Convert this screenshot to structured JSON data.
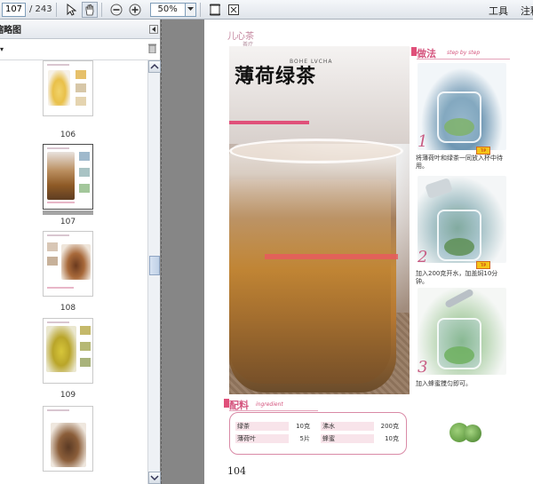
{
  "toolbar": {
    "current_page": "107",
    "total_pages": "/ 243",
    "zoom": "50%",
    "tools_label": "工具",
    "annotate_label": "注释"
  },
  "panel": {
    "title": "页面缩略图",
    "thumbnails": [
      {
        "page": "106"
      },
      {
        "page": "107"
      },
      {
        "page": "108"
      },
      {
        "page": "109"
      }
    ]
  },
  "recipe": {
    "brand": "儿心茶",
    "brand_sub": "茶疗",
    "title": "薄荷绿茶",
    "title_en": "BOHE LVCHA",
    "method_heading": "做法",
    "method_sub": "step by step",
    "steps": [
      {
        "num": "1",
        "text": "将薄荷叶和绿茶一同放入杯中待用。"
      },
      {
        "num": "2",
        "text": "加入200克开水，加盖焖10分钟。"
      },
      {
        "num": "3",
        "text": "加入蜂蜜搅匀即可。"
      }
    ],
    "ingredients_heading": "配料",
    "ingredients_sub": "ingredient",
    "ingredients": [
      {
        "name": "绿茶",
        "amount": "10克"
      },
      {
        "name": "薄荷叶",
        "amount": "5片"
      },
      {
        "name": "沸水",
        "amount": "200克"
      },
      {
        "name": "蜂蜜",
        "amount": "10克"
      }
    ],
    "page_number": "104"
  },
  "colors": {
    "accent": "#d4547d",
    "toolbar_bg": "#e6eaef",
    "workspace_bg": "#868686"
  }
}
